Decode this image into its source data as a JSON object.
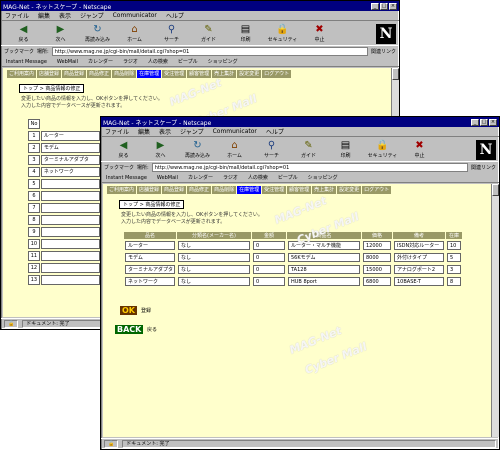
{
  "browser": {
    "title": "MAG-Net - ネットスケープ - Netscape",
    "menu": [
      "ファイル",
      "編集",
      "表示",
      "ジャンプ",
      "Communicator",
      "ヘルプ"
    ],
    "toolbar": [
      {
        "label": "戻る",
        "icon": "back-arrow-icon"
      },
      {
        "label": "次へ",
        "icon": "forward-arrow-icon"
      },
      {
        "label": "再読み込み",
        "icon": "reload-icon"
      },
      {
        "label": "ホーム",
        "icon": "home-icon"
      },
      {
        "label": "サーチ",
        "icon": "search-icon"
      },
      {
        "label": "ガイド",
        "icon": "guide-icon"
      },
      {
        "label": "印刷",
        "icon": "print-icon"
      },
      {
        "label": "セキュリティ",
        "icon": "security-lock-icon"
      },
      {
        "label": "中止",
        "icon": "stop-icon"
      }
    ],
    "logo": "N",
    "location_label": "ブックマーク",
    "location_sub": "場所:",
    "location_url": "http://www.mag.ne.jp/cgi-bin/mall/detail.cgi?shop=01",
    "related_label": "関連リンク",
    "personal_bar": [
      "Instant Message",
      "WebMail",
      "カレンダー",
      "ラジオ",
      "人の検索",
      "ピープル",
      "ショッピング"
    ],
    "status_text": "ドキュメント: 完了"
  },
  "mall": {
    "tabs": [
      "ご利用案内",
      "店舗登録",
      "商品登録",
      "商品修正",
      "商品削除",
      "在庫管理",
      "受注管理",
      "顧客管理",
      "売上集計",
      "設定変更",
      "ログアウト"
    ],
    "active_tab_index": 5,
    "section_title": "トップ > 商品情報の修正",
    "note_line1": "変更したい商品の情報を入力し、OKボタンを押してください。",
    "note_line2": "入力した内容でデータベースが更新されます。",
    "watermark1": "MAG-Net",
    "watermark2": "Cyber Mall"
  },
  "back_window_list": {
    "header": "No",
    "rows": [
      {
        "num": "1",
        "value": "ルーター"
      },
      {
        "num": "2",
        "value": "モデム"
      },
      {
        "num": "3",
        "value": "ターミナルアダプタ"
      },
      {
        "num": "4",
        "value": "ネットワーク"
      },
      {
        "num": "5",
        "value": ""
      },
      {
        "num": "6",
        "value": ""
      },
      {
        "num": "7",
        "value": ""
      },
      {
        "num": "8",
        "value": ""
      },
      {
        "num": "9",
        "value": ""
      },
      {
        "num": "10",
        "value": ""
      },
      {
        "num": "11",
        "value": ""
      },
      {
        "num": "12",
        "value": ""
      },
      {
        "num": "13",
        "value": ""
      }
    ]
  },
  "product_table": {
    "headers": [
      "品名",
      "分類名(メーカー名)",
      "金額",
      "商品名",
      "価格",
      "備考",
      "在庫"
    ],
    "rows": [
      {
        "label": "ルーター",
        "c1": "なし",
        "c2": "0",
        "c3": "ルーター・マルチ機能",
        "c4": "12000",
        "c5": "ISDN対応ルーター",
        "c6": "10"
      },
      {
        "label": "モデム",
        "c1": "なし",
        "c2": "0",
        "c3": "56Kモデム",
        "c4": "8000",
        "c5": "外付けタイプ",
        "c6": "5"
      },
      {
        "label": "ターミナルアダプタ",
        "c1": "なし",
        "c2": "0",
        "c3": "TA128",
        "c4": "15000",
        "c5": "アナログポート2",
        "c6": "3"
      },
      {
        "label": "ネットワーク",
        "c1": "なし",
        "c2": "0",
        "c3": "HUB 8port",
        "c4": "6800",
        "c5": "10BASE-T",
        "c6": "8"
      }
    ]
  },
  "actions": {
    "ok_label": "OK",
    "ok_text": "登録",
    "back_label": "BACK",
    "back_text": "戻る"
  }
}
